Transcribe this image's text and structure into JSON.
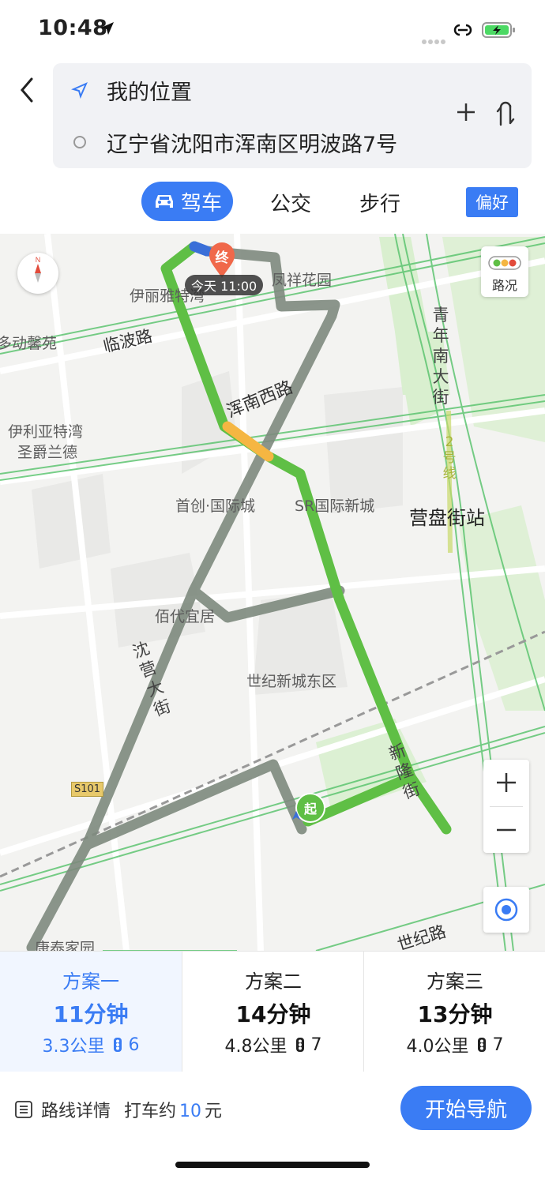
{
  "status_bar": {
    "time": "10:48"
  },
  "route": {
    "origin": "我的位置",
    "destination": "辽宁省沈阳市浑南区明波路7号"
  },
  "modes": {
    "drive": "驾车",
    "bus": "公交",
    "walk": "步行",
    "preference": "偏好"
  },
  "map": {
    "traffic_label": "路况",
    "end_marker": "终",
    "start_marker": "起",
    "arrival_tag": "今天 11:00",
    "labels": {
      "fengxiang": "凤祥花园",
      "yiliya": "伊丽雅特湾",
      "dongxin": "多动馨苑",
      "linbo": "临波路",
      "hunnanxi": "浑南西路",
      "yilia2_line1": "伊利亚特湾",
      "yilia2_line2": "圣爵兰德",
      "shouchuang": "首创·国际城",
      "sr": "SR国际新城",
      "yingpan": "营盘街站",
      "qingnian": "青年南大街",
      "line2": "2号线",
      "baidai": "佰代宜居",
      "shiji_east": "世纪新城东区",
      "shenying": "沈营大街",
      "xinlong": "新隆街",
      "s101": "S101",
      "kangtai": "康泰家园",
      "shijilu": "世纪路"
    }
  },
  "plans": [
    {
      "name": "方案一",
      "duration": "11分钟",
      "distance": "3.3公里",
      "lights": "6"
    },
    {
      "name": "方案二",
      "duration": "14分钟",
      "distance": "4.8公里",
      "lights": "7"
    },
    {
      "name": "方案三",
      "duration": "13分钟",
      "distance": "4.0公里",
      "lights": "7"
    }
  ],
  "bottom": {
    "detail": "路线详情",
    "taxi_prefix": "打车约",
    "taxi_fare": "10",
    "taxi_unit": "元",
    "start_nav": "开始导航"
  },
  "colors": {
    "accent": "#3a7cf4",
    "route_green": "#5fbf45",
    "route_gray": "#8e9a8e",
    "route_orange": "#f5b642"
  }
}
